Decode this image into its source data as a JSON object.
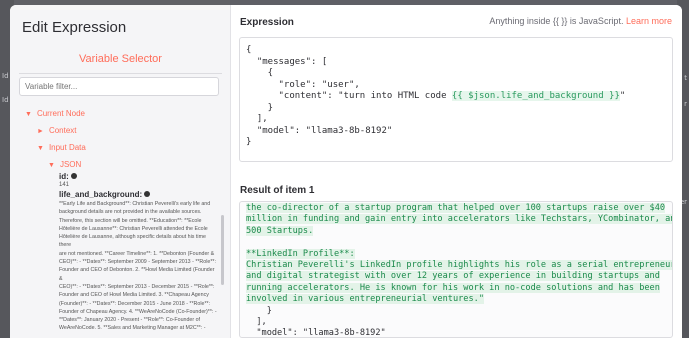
{
  "background": {
    "left_labels": [
      "Id",
      "Id"
    ],
    "right_labels": [
      "t",
      "r",
      "er"
    ]
  },
  "panel": {
    "title": "Edit Expression",
    "variable_selector": "Variable Selector",
    "filter_placeholder": "Variable filter...",
    "tree": {
      "current_node": "Current Node",
      "context": "Context",
      "input_data": "Input Data",
      "json": "JSON",
      "id_key": "id:",
      "id_value": "141",
      "life_key": "life_and_background:",
      "life_value_lines": [
        "**Early Life and Background**: Christian Peverelli's early life and",
        "background details are not provided in the available sources.",
        "Therefore, this section will be omitted. **Education**: **Ecole",
        "Hôtelière de Lausanne**: Christian Peverelli attended the Ecole",
        "Hôtelière de Lausanne, although specific details about his time there",
        "are not mentioned. **Career Timeline**: 1. **Debonton (Founder &",
        "CEO)**: - **Dates**: September 2009 - September 2013 - **Role**:",
        "Founder and CEO of Debonton. 2. **Howl Media Limited (Founder &",
        "CEO)**: - **Dates**: September 2013 - December 2015 - **Role**:",
        "Founder and CEO of Howl Media Limited. 3. **Chapeau Agency",
        "(Founder)**: - **Dates**: December 2015 - June 2018 - **Role**:",
        "Founder of Chapeau Agency. 4. **WeAreNoCode (Co-Founder)**: -",
        "**Dates**: January 2020 - Present - **Role**: Co-Founder of",
        "WeAreNoCode. 5. **Sales and Marketing Manager at M2C**: -"
      ]
    }
  },
  "expression": {
    "label": "Expression",
    "hint_prefix": "Anything inside {{ }} is JavaScript.",
    "learn_more": "Learn more",
    "lines": [
      {
        "text": "{"
      },
      {
        "text": "  \"messages\": ["
      },
      {
        "text": "    {"
      },
      {
        "text": "      \"role\": \"user\","
      },
      {
        "pre": "      \"content\": \"turn into HTML code ",
        "tmpl": "{{ $json.life_and_background }}",
        "post": "\""
      },
      {
        "text": "    }"
      },
      {
        "text": "  ],"
      },
      {
        "text": "  \"model\": \"llama3-8b-8192\""
      },
      {
        "text": "}"
      }
    ]
  },
  "result": {
    "label": "Result of item 1",
    "lines": [
      "the co-director of a startup program that helped over 100 startups raise over $40",
      "million in funding and gain entry into accelerators like Techstars, YCombinator, and",
      "500 Startups.",
      "",
      "**LinkedIn Profile**:",
      "Christian Peverelli's LinkedIn profile highlights his role as a serial entrepreneur",
      "and digital strategist with over 12 years of experience in building startups and",
      "running accelerators. He is known for his work in no-code solutions and has been",
      "involved in various entrepreneurial ventures.\"",
      "    }",
      "  ],",
      "  \"model\": \"llama3-8b-8192\""
    ]
  },
  "colors": {
    "accent": "#ff6d5a",
    "template": "#2a9a5e",
    "result_text": "#1b8a4b"
  }
}
